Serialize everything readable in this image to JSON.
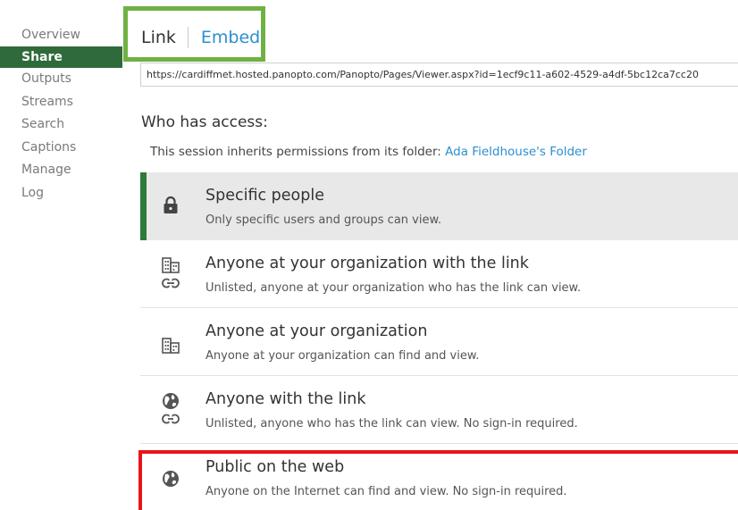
{
  "sidebar": {
    "items": [
      {
        "label": "Overview"
      },
      {
        "label": "Share"
      },
      {
        "label": "Outputs"
      },
      {
        "label": "Streams"
      },
      {
        "label": "Search"
      },
      {
        "label": "Captions"
      },
      {
        "label": "Manage"
      },
      {
        "label": "Log"
      }
    ],
    "active": "Share"
  },
  "tabs": {
    "link_label": "Link",
    "embed_label": "Embed"
  },
  "url_field": {
    "value": "https://cardiffmet.hosted.panopto.com/Panopto/Pages/Viewer.aspx?id=1ecf9c11-a602-4529-a4df-5bc12ca7cc20"
  },
  "access": {
    "title": "Who has access:",
    "inherit_text": "This session inherits permissions from its folder:",
    "folder_link": "Ada Fieldhouse's Folder",
    "options": [
      {
        "title": "Specific people",
        "desc": "Only specific users and groups can view.",
        "icon": "lock-icon",
        "selected": true
      },
      {
        "title": "Anyone at your organization with the link",
        "desc": "Unlisted, anyone at your organization who has the link can view.",
        "icon": "building-icon, link-icon"
      },
      {
        "title": "Anyone at your organization",
        "desc": "Anyone at your organization can find and view.",
        "icon": "building-icon"
      },
      {
        "title": "Anyone with the link",
        "desc": "Unlisted, anyone who has the link can view. No sign-in required.",
        "icon": "globe-icon, link-icon"
      },
      {
        "title": "Public on the web",
        "desc": "Anyone on the Internet can find and view. No sign-in required.",
        "icon": "globe-icon"
      }
    ]
  },
  "colors": {
    "sidebar_active": "#2f6b3a",
    "selected_bar": "#2f7a3b",
    "link_blue": "#2b8fd0",
    "tab_highlight": "#6fb143",
    "public_highlight": "#e8141b"
  }
}
